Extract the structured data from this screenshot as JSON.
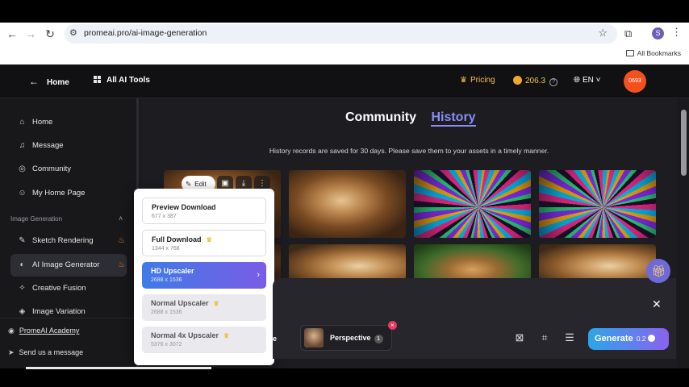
{
  "browser": {
    "url": "promeai.pro/ai-image-generation",
    "profile_initial": "S",
    "bookmarks_label": "All Bookmarks"
  },
  "topbar": {
    "home": "Home",
    "all_tools": "All AI Tools",
    "pricing": "Pricing",
    "credits": "206.3",
    "language": "EN",
    "avatar_text": "0693"
  },
  "sidebar": {
    "items": [
      {
        "label": "Home",
        "icon": "home-icon"
      },
      {
        "label": "Message",
        "icon": "bell-icon"
      },
      {
        "label": "Community",
        "icon": "compass-icon"
      },
      {
        "label": "My Home Page",
        "icon": "user-icon"
      }
    ],
    "section": "Image Generation",
    "gen_items": [
      {
        "label": "Sketch Rendering",
        "hot": true
      },
      {
        "label": "AI Image Generator",
        "hot": true
      },
      {
        "label": "Creative Fusion",
        "hot": false
      },
      {
        "label": "Image Variation",
        "hot": false
      }
    ],
    "academy": "PromeAI Academy",
    "send_message": "Send us a message"
  },
  "main": {
    "tabs": [
      "Community",
      "History"
    ],
    "active_tab": "History",
    "notice": "History records are saved for 30 days. Please save them to your assets in a timely manner.",
    "edit_label": "Edit"
  },
  "download_menu": {
    "options": [
      {
        "title": "Preview Download",
        "size": "677 x 387"
      },
      {
        "title": "Full Download",
        "size": "1344 x 768"
      },
      {
        "title": "HD Upscaler",
        "size": "2688 x 1536"
      },
      {
        "title": "Normal Upscaler",
        "size": "2688 x 1536"
      },
      {
        "title": "Normal 4x Upscaler",
        "size": "5376 x 3072"
      }
    ]
  },
  "generate": {
    "style_label": "Perspective",
    "style_count": "1",
    "button_label": "Generate",
    "cost": "0.2"
  },
  "colors": {
    "accent": "#8b8cf3",
    "pricing": "#f5c24a",
    "avatar": "#f4511e",
    "fire": "#ff7a1a"
  }
}
